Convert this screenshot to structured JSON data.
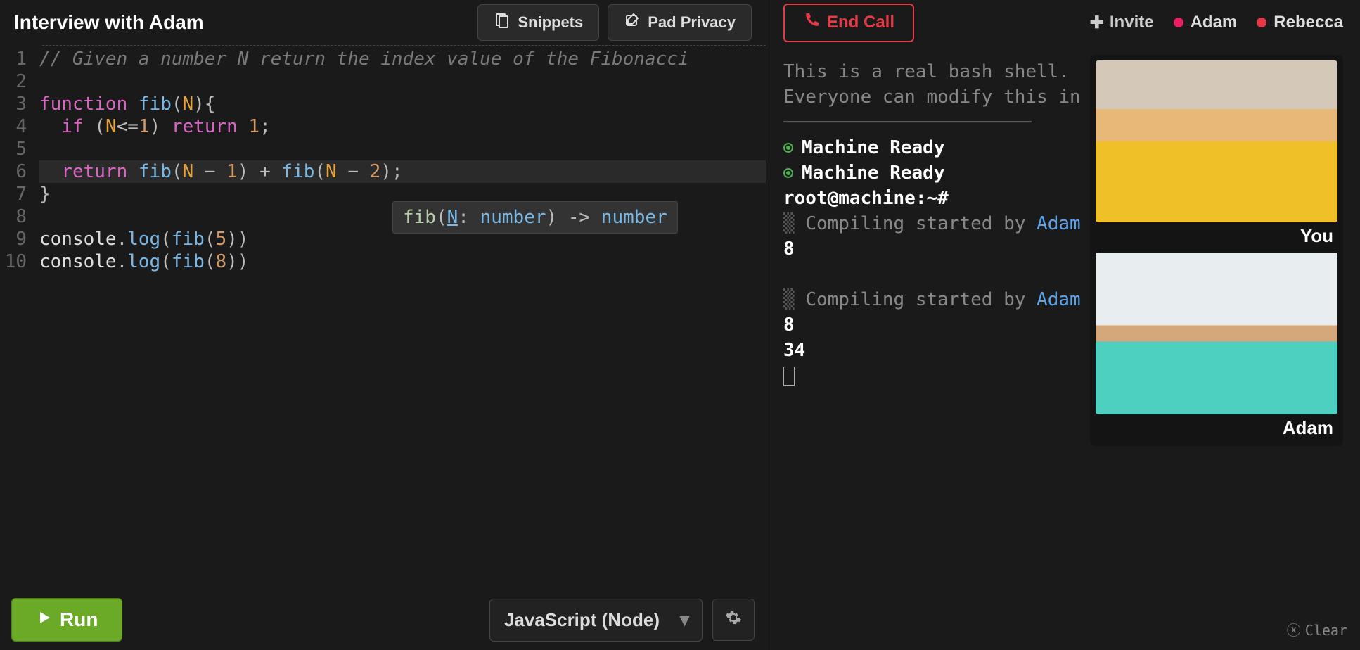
{
  "header": {
    "title": "Interview with Adam",
    "snippets_label": "Snippets",
    "pad_privacy_label": "Pad Privacy"
  },
  "call": {
    "end_call_label": "End Call",
    "invite_label": "Invite",
    "participants": [
      {
        "name": "Adam",
        "color": "pink"
      },
      {
        "name": "Rebecca",
        "color": "red"
      }
    ]
  },
  "editor": {
    "lines": [
      {
        "n": 1,
        "type": "comment",
        "text": "// Given a number N return the index value of the Fibonacci"
      },
      {
        "n": 2,
        "type": "blank",
        "text": ""
      },
      {
        "n": 3,
        "type": "code",
        "tokens": [
          "function ",
          "fib",
          "(",
          "N",
          ")",
          "{"
        ]
      },
      {
        "n": 4,
        "type": "code",
        "tokens": [
          "  ",
          "if",
          " (",
          "N",
          "<=",
          "1",
          ") ",
          "return",
          " ",
          "1",
          ";"
        ]
      },
      {
        "n": 5,
        "type": "blank",
        "text": ""
      },
      {
        "n": 6,
        "type": "code",
        "active": true,
        "tokens": [
          "  ",
          "return",
          " ",
          "fib",
          "(",
          "N",
          " − ",
          "1",
          ")",
          " + ",
          "fib",
          "(",
          "N",
          " − ",
          "2",
          ")",
          ";"
        ]
      },
      {
        "n": 7,
        "type": "code",
        "tokens": [
          "}"
        ]
      },
      {
        "n": 8,
        "type": "blank",
        "text": ""
      },
      {
        "n": 9,
        "type": "code",
        "tokens": [
          "console",
          ".",
          "log",
          "(",
          "fib",
          "(",
          "5",
          ")",
          ")"
        ]
      },
      {
        "n": 10,
        "type": "code",
        "tokens": [
          "console",
          ".",
          "log",
          "(",
          "fib",
          "(",
          "8",
          ")",
          ")"
        ]
      }
    ],
    "hint": {
      "fn": "fib",
      "param": "N",
      "param_type": "number",
      "return_type": "number"
    }
  },
  "footer": {
    "run_label": "Run",
    "language": "JavaScript (Node)"
  },
  "terminal": {
    "intro1": "This is a real bash shell.",
    "intro2": "Everyone can modify this in",
    "ready": "Machine Ready",
    "prompt": "root@machine:~#",
    "compiling_prefix": "Compiling started by ",
    "compiling_user": "Adam",
    "outputs": [
      [
        "8"
      ],
      [
        "8",
        "34"
      ]
    ],
    "clear_label": "Clear"
  },
  "video": {
    "tiles": [
      {
        "label": "You",
        "cls": "rebecca"
      },
      {
        "label": "Adam",
        "cls": "adam"
      }
    ]
  }
}
